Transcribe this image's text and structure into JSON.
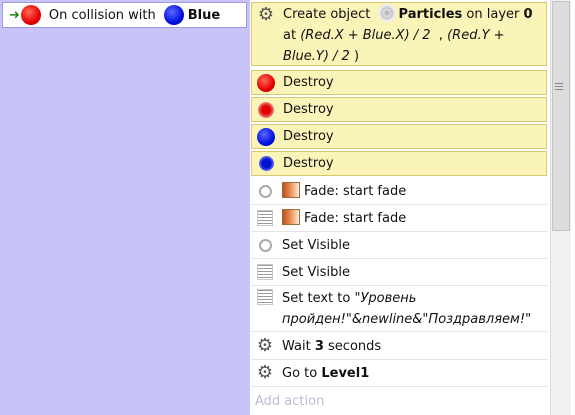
{
  "condition": {
    "arrow": "➜",
    "red_object": "Red",
    "label": "On collision with",
    "target": "Blue"
  },
  "actions": [
    {
      "icon": "gear-icon",
      "prefix": "Create object",
      "object": "Particles",
      "mid": "on layer",
      "layer": "0",
      "line2a": "at",
      "expr_x": "(Red.X + Blue.X) / 2",
      "sep": ",",
      "expr_y1": "(Red.Y +",
      "expr_y2": "Blue.Y) / 2",
      "close": ")"
    },
    {
      "icon": "red-circle-icon",
      "text": "Destroy"
    },
    {
      "icon": "red-particle-icon",
      "text": "Destroy"
    },
    {
      "icon": "blue-circle-icon",
      "text": "Destroy"
    },
    {
      "icon": "blue-particle-icon",
      "text": "Destroy"
    },
    {
      "icon": "ring-icon",
      "text": "Fade: start fade"
    },
    {
      "icon": "text-object-icon",
      "text": "Fade: start fade"
    },
    {
      "icon": "ring-icon",
      "text": "Set Visible"
    },
    {
      "icon": "text-object-icon",
      "text": "Set Visible"
    },
    {
      "icon": "text-object-icon",
      "prefix": "Set text to",
      "line1": "\"Уровень",
      "line2": "пройден!\"&newline&\"Поздравляем!\""
    },
    {
      "icon": "gear-icon",
      "prefix": "Wait",
      "value": "3",
      "suffix": "seconds"
    },
    {
      "icon": "gear-icon",
      "prefix": "Go to",
      "value": "Level1"
    }
  ],
  "add_action": "Add action"
}
